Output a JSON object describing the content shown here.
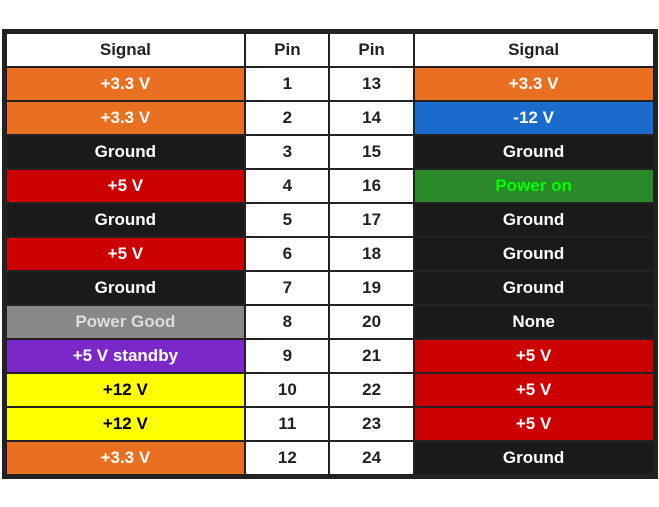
{
  "header": {
    "col1": "Signal",
    "col2": "Pin",
    "col3": "Pin",
    "col4": "Signal"
  },
  "rows": [
    {
      "leftLabel": "+3.3 V",
      "leftBg": "bg-orange",
      "pinLeft": "1",
      "pinRight": "13",
      "rightLabel": "+3.3 V",
      "rightBg": "bg-orange"
    },
    {
      "leftLabel": "+3.3 V",
      "leftBg": "bg-orange",
      "pinLeft": "2",
      "pinRight": "14",
      "rightLabel": "-12 V",
      "rightBg": "bg-blue"
    },
    {
      "leftLabel": "Ground",
      "leftBg": "bg-black",
      "pinLeft": "3",
      "pinRight": "15",
      "rightLabel": "Ground",
      "rightBg": "bg-black"
    },
    {
      "leftLabel": "+5 V",
      "leftBg": "bg-red",
      "pinLeft": "4",
      "pinRight": "16",
      "rightLabel": "Power on",
      "rightBg": "bg-green"
    },
    {
      "leftLabel": "Ground",
      "leftBg": "bg-black",
      "pinLeft": "5",
      "pinRight": "17",
      "rightLabel": "Ground",
      "rightBg": "bg-black"
    },
    {
      "leftLabel": "+5 V",
      "leftBg": "bg-red",
      "pinLeft": "6",
      "pinRight": "18",
      "rightLabel": "Ground",
      "rightBg": "bg-black"
    },
    {
      "leftLabel": "Ground",
      "leftBg": "bg-black",
      "pinLeft": "7",
      "pinRight": "19",
      "rightLabel": "Ground",
      "rightBg": "bg-black"
    },
    {
      "leftLabel": "Power Good",
      "leftBg": "bg-gray",
      "pinLeft": "8",
      "pinRight": "20",
      "rightLabel": "None",
      "rightBg": "bg-none"
    },
    {
      "leftLabel": "+5 V standby",
      "leftBg": "bg-purple",
      "pinLeft": "9",
      "pinRight": "21",
      "rightLabel": "+5 V",
      "rightBg": "bg-red"
    },
    {
      "leftLabel": "+12 V",
      "leftBg": "bg-yellow",
      "pinLeft": "10",
      "pinRight": "22",
      "rightLabel": "+5 V",
      "rightBg": "bg-red"
    },
    {
      "leftLabel": "+12 V",
      "leftBg": "bg-yellow",
      "pinLeft": "11",
      "pinRight": "23",
      "rightLabel": "+5 V",
      "rightBg": "bg-red"
    },
    {
      "leftLabel": "+3.3 V",
      "leftBg": "bg-orange",
      "pinLeft": "12",
      "pinRight": "24",
      "rightLabel": "Ground",
      "rightBg": "bg-black"
    }
  ]
}
